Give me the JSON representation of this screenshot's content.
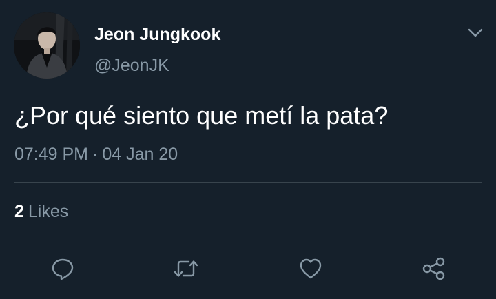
{
  "tweet": {
    "display_name": "Jeon Jungkook",
    "handle": "@JeonJK",
    "text": "¿Por qué siento que metí la pata?",
    "time": "07:49 PM",
    "separator": "·",
    "date": "04 Jan 20",
    "likes_count": "2",
    "likes_label": "Likes"
  },
  "icons": {
    "menu": "chevron-down-icon",
    "reply": "reply-icon",
    "retweet": "retweet-icon",
    "like": "heart-icon",
    "share": "share-icon"
  },
  "colors": {
    "background": "#15202b",
    "primary_text": "#ffffff",
    "secondary_text": "#8899a6",
    "divider": "#38444d"
  }
}
